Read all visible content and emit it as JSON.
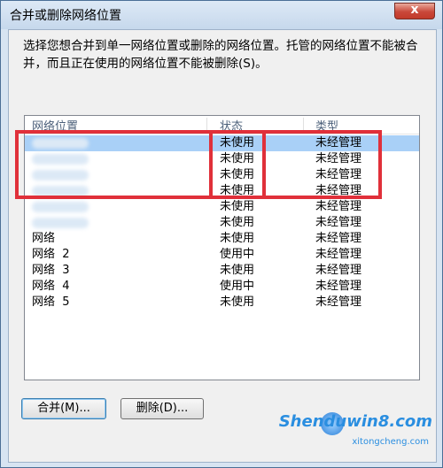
{
  "window": {
    "title": "合并或删除网络位置",
    "close_label": "x"
  },
  "instructions": "选择您想合并到单一网络位置或删除的网络位置。托管的网络位置不能被合并，而且正在使用的网络位置不能被删除(S)。",
  "table": {
    "headers": [
      "网络位置",
      "状态",
      "类型"
    ],
    "rows": [
      {
        "name": "",
        "status": "未使用",
        "type": "未经管理",
        "selected": true
      },
      {
        "name": "",
        "status": "未使用",
        "type": "未经管理"
      },
      {
        "name": "",
        "status": "未使用",
        "type": "未经管理"
      },
      {
        "name": "",
        "status": "未使用",
        "type": "未经管理"
      },
      {
        "name": "",
        "status": "未使用",
        "type": "未经管理"
      },
      {
        "name": "",
        "status": "未使用",
        "type": "未经管理"
      },
      {
        "name": "网络",
        "status": "未使用",
        "type": "未经管理"
      },
      {
        "name": "网络  2",
        "status": "使用中",
        "type": "未经管理"
      },
      {
        "name": "网络  3",
        "status": "未使用",
        "type": "未经管理"
      },
      {
        "name": "网络  4",
        "status": "使用中",
        "type": "未经管理"
      },
      {
        "name": "网络  5",
        "status": "未使用",
        "type": "未经管理"
      }
    ]
  },
  "buttons": {
    "merge": "合并(M)...",
    "delete": "删除(D)..."
  },
  "watermark": {
    "text": "Shenduwin8.com",
    "sub": "xitongcheng.com"
  },
  "colors": {
    "highlight": "#e0303a",
    "selection": "#a9d0f7"
  }
}
